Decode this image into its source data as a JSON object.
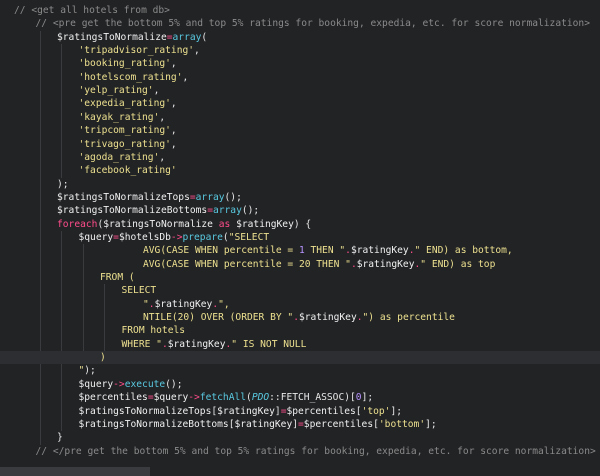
{
  "lines": [
    {
      "indent": 0,
      "tokens": [
        [
          "c-comment",
          "// <get all hotels from db>"
        ]
      ]
    },
    {
      "indent": 1,
      "tokens": [
        [
          "c-comment",
          "// <pre get the bottom 5% and top 5% ratings for booking, expedia, etc. for score normalization>"
        ]
      ]
    },
    {
      "indent": 2,
      "tokens": [
        [
          "c-var",
          "$ratingsToNormalize"
        ],
        [
          "c-op",
          "="
        ],
        [
          "c-func",
          "array"
        ],
        [
          "c-punc",
          "("
        ]
      ]
    },
    {
      "indent": 3,
      "tokens": [
        [
          "c-str",
          "'tripadvisor_rating'"
        ],
        [
          "c-punc",
          ","
        ]
      ]
    },
    {
      "indent": 3,
      "tokens": [
        [
          "c-str",
          "'booking_rating'"
        ],
        [
          "c-punc",
          ","
        ]
      ]
    },
    {
      "indent": 3,
      "tokens": [
        [
          "c-str",
          "'hotelscom_rating'"
        ],
        [
          "c-punc",
          ","
        ]
      ]
    },
    {
      "indent": 3,
      "tokens": [
        [
          "c-str",
          "'yelp_rating'"
        ],
        [
          "c-punc",
          ","
        ]
      ]
    },
    {
      "indent": 3,
      "tokens": [
        [
          "c-str",
          "'expedia_rating'"
        ],
        [
          "c-punc",
          ","
        ]
      ]
    },
    {
      "indent": 3,
      "tokens": [
        [
          "c-str",
          "'kayak_rating'"
        ],
        [
          "c-punc",
          ","
        ]
      ]
    },
    {
      "indent": 3,
      "tokens": [
        [
          "c-str",
          "'tripcom_rating'"
        ],
        [
          "c-punc",
          ","
        ]
      ]
    },
    {
      "indent": 3,
      "tokens": [
        [
          "c-str",
          "'trivago_rating'"
        ],
        [
          "c-punc",
          ","
        ]
      ]
    },
    {
      "indent": 3,
      "tokens": [
        [
          "c-str",
          "'agoda_rating'"
        ],
        [
          "c-punc",
          ","
        ]
      ]
    },
    {
      "indent": 3,
      "tokens": [
        [
          "c-str",
          "'facebook_rating'"
        ]
      ]
    },
    {
      "indent": 2,
      "tokens": [
        [
          "c-punc",
          ");"
        ]
      ]
    },
    {
      "indent": 2,
      "tokens": [
        [
          "c-var",
          "$ratingsToNormalizeTops"
        ],
        [
          "c-op",
          "="
        ],
        [
          "c-func",
          "array"
        ],
        [
          "c-punc",
          "();"
        ]
      ]
    },
    {
      "indent": 2,
      "tokens": [
        [
          "c-var",
          "$ratingsToNormalizeBottoms"
        ],
        [
          "c-op",
          "="
        ],
        [
          "c-func",
          "array"
        ],
        [
          "c-punc",
          "();"
        ]
      ]
    },
    {
      "indent": 2,
      "tokens": [
        [
          "c-kw",
          "foreach"
        ],
        [
          "c-punc",
          "("
        ],
        [
          "c-var",
          "$ratingsToNormalize "
        ],
        [
          "c-kw",
          "as"
        ],
        [
          "c-var",
          " $ratingKey"
        ],
        [
          "c-punc",
          ") {"
        ]
      ]
    },
    {
      "indent": 3,
      "tokens": [
        [
          "c-var",
          "$query"
        ],
        [
          "c-op",
          "="
        ],
        [
          "c-var",
          "$hotelsDb"
        ],
        [
          "c-op",
          "->"
        ],
        [
          "c-func",
          "prepare"
        ],
        [
          "c-punc",
          "("
        ],
        [
          "c-str",
          "\"SELECT"
        ]
      ]
    },
    {
      "indent": 6,
      "tokens": [
        [
          "c-str",
          "AVG(CASE WHEN percentile = "
        ],
        [
          "c-num",
          "1"
        ],
        [
          "c-str",
          " THEN \""
        ],
        [
          "c-op",
          "."
        ],
        [
          "c-var",
          "$ratingKey"
        ],
        [
          "c-op",
          "."
        ],
        [
          "c-str",
          "\" END) as bottom,"
        ]
      ]
    },
    {
      "indent": 6,
      "tokens": [
        [
          "c-str",
          "AVG(CASE WHEN percentile = 20 THEN \""
        ],
        [
          "c-op",
          "."
        ],
        [
          "c-var",
          "$ratingKey"
        ],
        [
          "c-op",
          "."
        ],
        [
          "c-str",
          "\" END) as top"
        ]
      ]
    },
    {
      "indent": 4,
      "tokens": [
        [
          "c-str",
          "FROM ("
        ]
      ]
    },
    {
      "indent": 5,
      "tokens": [
        [
          "c-str",
          "SELECT"
        ]
      ]
    },
    {
      "indent": 6,
      "tokens": [
        [
          "c-str",
          "\""
        ],
        [
          "c-op",
          "."
        ],
        [
          "c-var",
          "$ratingKey"
        ],
        [
          "c-op",
          "."
        ],
        [
          "c-str",
          "\","
        ]
      ]
    },
    {
      "indent": 6,
      "tokens": [
        [
          "c-str",
          "NTILE(20) OVER (ORDER BY \""
        ],
        [
          "c-op",
          "."
        ],
        [
          "c-var",
          "$ratingKey"
        ],
        [
          "c-op",
          "."
        ],
        [
          "c-str",
          "\") as percentile"
        ]
      ]
    },
    {
      "indent": 5,
      "tokens": [
        [
          "c-str",
          "FROM hotels"
        ]
      ]
    },
    {
      "indent": 5,
      "tokens": [
        [
          "c-str",
          "WHERE \""
        ],
        [
          "c-op",
          "."
        ],
        [
          "c-var",
          "$ratingKey"
        ],
        [
          "c-op",
          "."
        ],
        [
          "c-str",
          "\" IS NOT NULL"
        ]
      ]
    },
    {
      "indent": 4,
      "tokens": [
        [
          "c-str",
          ")"
        ]
      ],
      "current": true
    },
    {
      "indent": 3,
      "tokens": [
        [
          "c-str",
          "\""
        ],
        [
          "c-punc",
          ");"
        ]
      ]
    },
    {
      "indent": 3,
      "tokens": [
        [
          "c-var",
          "$query"
        ],
        [
          "c-op",
          "->"
        ],
        [
          "c-func",
          "execute"
        ],
        [
          "c-punc",
          "();"
        ]
      ]
    },
    {
      "indent": 3,
      "tokens": [
        [
          "c-var",
          "$percentiles"
        ],
        [
          "c-op",
          "="
        ],
        [
          "c-var",
          "$query"
        ],
        [
          "c-op",
          "->"
        ],
        [
          "c-func",
          "fetchAll"
        ],
        [
          "c-punc",
          "("
        ],
        [
          "c-italic",
          "PDO"
        ],
        [
          "c-punc",
          "::FETCH_ASSOC)["
        ],
        [
          "c-num",
          "0"
        ],
        [
          "c-punc",
          "];"
        ]
      ]
    },
    {
      "indent": 3,
      "tokens": [
        [
          "c-var",
          "$ratingsToNormalizeTops"
        ],
        [
          "c-punc",
          "["
        ],
        [
          "c-var",
          "$ratingKey"
        ],
        [
          "c-punc",
          "]"
        ],
        [
          "c-op",
          "="
        ],
        [
          "c-var",
          "$percentiles"
        ],
        [
          "c-punc",
          "["
        ],
        [
          "c-str",
          "'top'"
        ],
        [
          "c-punc",
          "];"
        ]
      ]
    },
    {
      "indent": 3,
      "tokens": [
        [
          "c-var",
          "$ratingsToNormalizeBottoms"
        ],
        [
          "c-punc",
          "["
        ],
        [
          "c-var",
          "$ratingKey"
        ],
        [
          "c-punc",
          "]"
        ],
        [
          "c-op",
          "="
        ],
        [
          "c-var",
          "$percentiles"
        ],
        [
          "c-punc",
          "["
        ],
        [
          "c-str",
          "'bottom'"
        ],
        [
          "c-punc",
          "];"
        ]
      ]
    },
    {
      "indent": 2,
      "tokens": [
        [
          "c-punc",
          "}"
        ]
      ]
    },
    {
      "indent": 1,
      "tokens": [
        [
          "c-comment",
          "// </pre get the bottom 5% and top 5% ratings for booking, expedia, etc. for score normalization>"
        ]
      ]
    }
  ]
}
